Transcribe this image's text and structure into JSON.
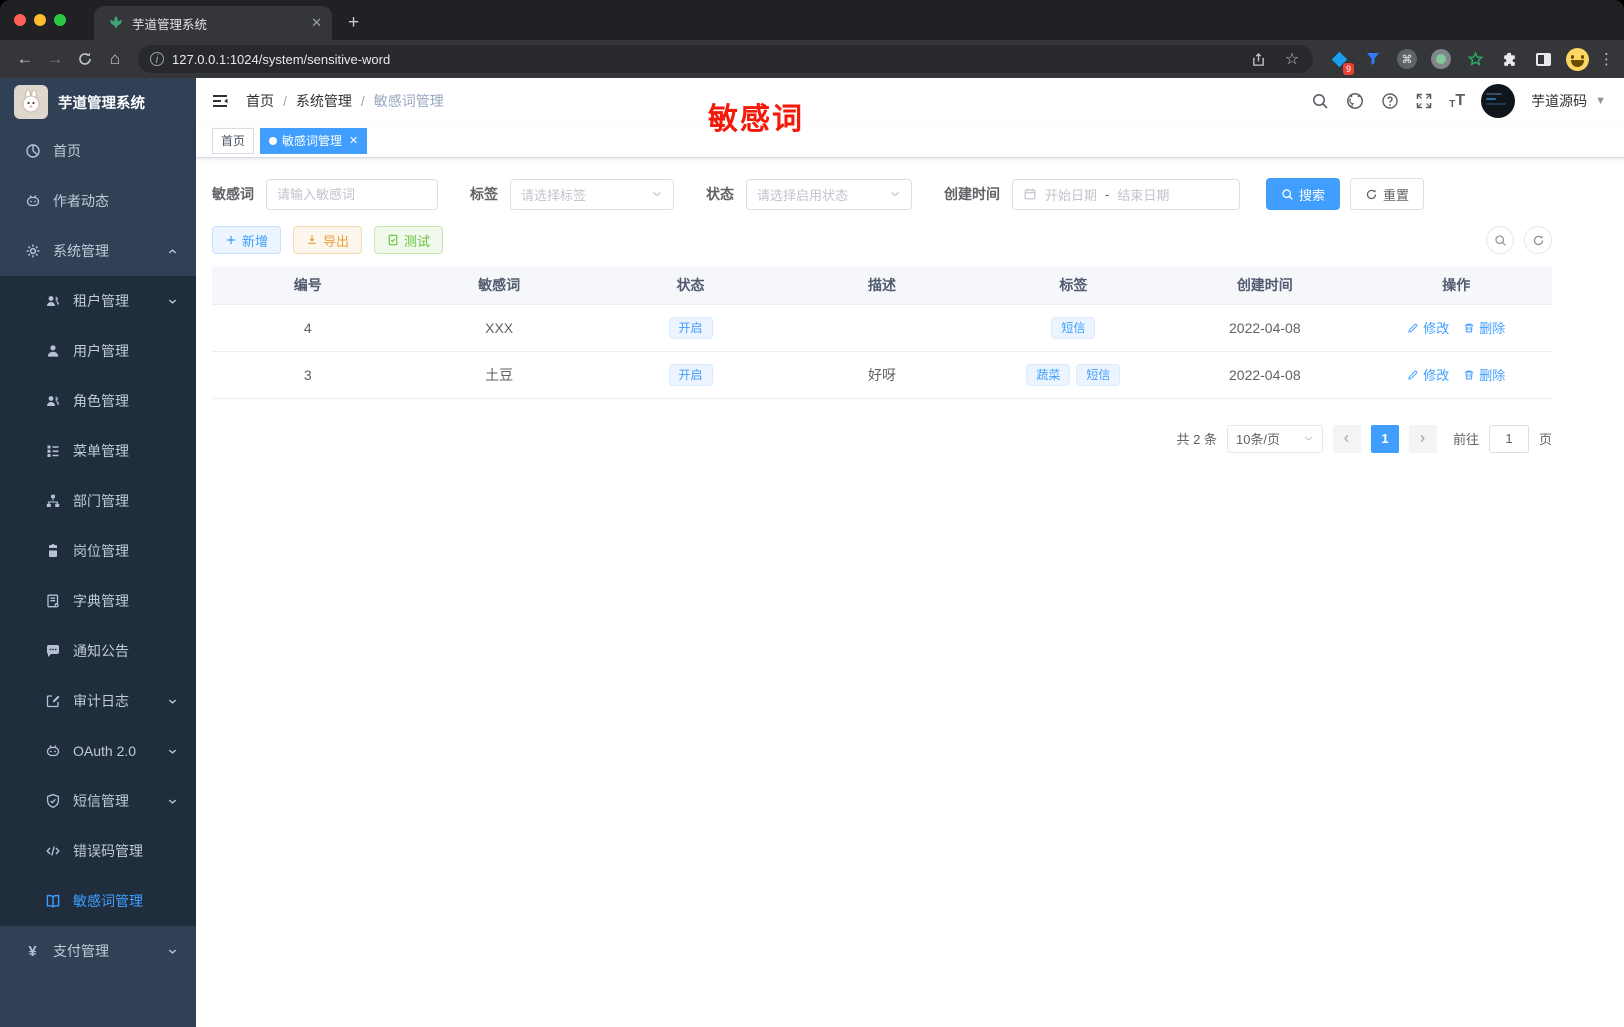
{
  "theme": {
    "primary": "#409eff",
    "sidebar_bg": "#304156",
    "submenu_bg": "#1f2d3d",
    "warning": "#e6a23c",
    "success": "#67c23a",
    "annotation_red": "#f5190a"
  },
  "browser": {
    "tab_title": "芋道管理系统",
    "url": "127.0.0.1:1024/system/sensitive-word",
    "extension_badge": "9",
    "cmd_glyph": "⌘"
  },
  "sidebar": {
    "logo_title": "芋道管理系统",
    "items": [
      {
        "label": "首页"
      },
      {
        "label": "作者动态"
      },
      {
        "label": "系统管理"
      },
      {
        "label": "租户管理"
      },
      {
        "label": "用户管理"
      },
      {
        "label": "角色管理"
      },
      {
        "label": "菜单管理"
      },
      {
        "label": "部门管理"
      },
      {
        "label": "岗位管理"
      },
      {
        "label": "字典管理"
      },
      {
        "label": "通知公告"
      },
      {
        "label": "审计日志"
      },
      {
        "label": "OAuth 2.0"
      },
      {
        "label": "短信管理"
      },
      {
        "label": "错误码管理"
      },
      {
        "label": "敏感词管理"
      },
      {
        "label": "支付管理"
      }
    ]
  },
  "header": {
    "breadcrumb": {
      "home": "首页",
      "section": "系统管理",
      "current": "敏感词管理"
    },
    "annotation": "敏感词",
    "username": "芋道源码"
  },
  "tags_bar": {
    "home": "首页",
    "active": "敏感词管理"
  },
  "filters": {
    "keyword_label": "敏感词",
    "keyword_placeholder": "请输入敏感词",
    "tag_label": "标签",
    "tag_placeholder": "请选择标签",
    "status_label": "状态",
    "status_placeholder": "请选择启用状态",
    "date_label": "创建时间",
    "date_start_placeholder": "开始日期",
    "date_separator": "-",
    "date_end_placeholder": "结束日期",
    "search_label": "搜索",
    "reset_label": "重置"
  },
  "toolbar": {
    "add_label": "新增",
    "export_label": "导出",
    "test_label": "测试"
  },
  "table": {
    "columns": {
      "id": "编号",
      "word": "敏感词",
      "status": "状态",
      "desc": "描述",
      "tags": "标签",
      "created": "创建时间",
      "actions": "操作"
    },
    "rows": [
      {
        "id": "4",
        "word": "XXX",
        "status": "开启",
        "desc": "",
        "tags": [
          "短信"
        ],
        "created": "2022-04-08"
      },
      {
        "id": "3",
        "word": "土豆",
        "status": "开启",
        "desc": "好呀",
        "tags": [
          "蔬菜",
          "短信"
        ],
        "created": "2022-04-08"
      }
    ],
    "edit_label": "修改",
    "delete_label": "删除"
  },
  "pagination": {
    "total": "共 2 条",
    "page_size": "10条/页",
    "current_page": "1",
    "goto_label": "前往",
    "goto_value": "1",
    "page_unit": "页"
  }
}
